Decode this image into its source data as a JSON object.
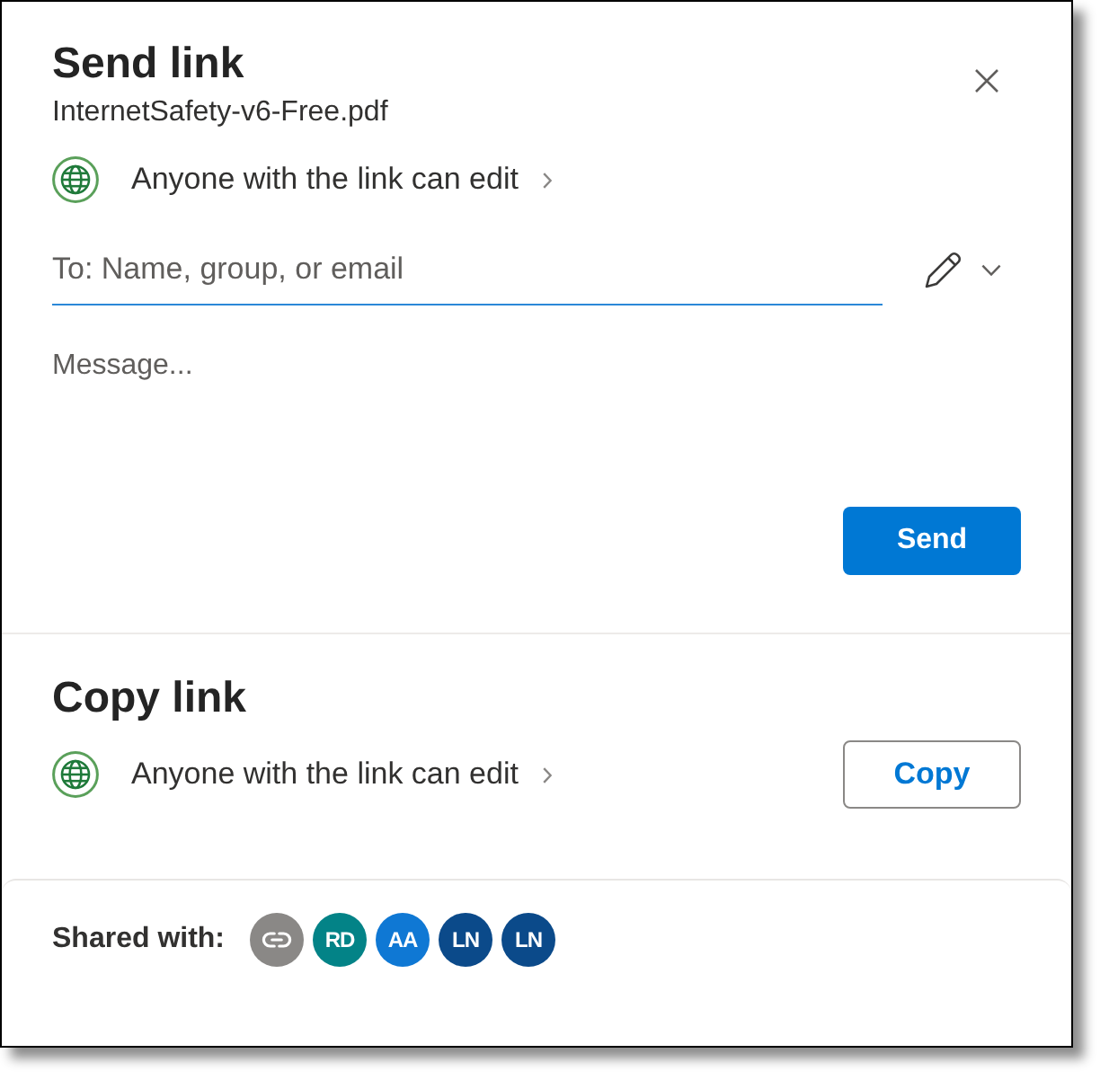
{
  "send_link": {
    "title": "Send link",
    "file_name": "InternetSafety-v6-Free.pdf",
    "permission": "Anyone with the link can edit",
    "recipient_field": {
      "placeholder": "To: Name, group, or email",
      "focused": true
    },
    "message_field": {
      "placeholder": "Message..."
    },
    "send_button": "Send"
  },
  "copy_link": {
    "title": "Copy link",
    "permission": "Anyone with the link can edit",
    "copy_button": "Copy"
  },
  "shared_with": {
    "label": "Shared with:",
    "people": [
      {
        "kind": "link",
        "color": "#8a8886"
      },
      {
        "kind": "initials",
        "initials": "RD",
        "color": "#038387"
      },
      {
        "kind": "initials",
        "initials": "AA",
        "color": "#0f78d4"
      },
      {
        "kind": "initials",
        "initials": "LN",
        "color": "#0b4a8a"
      },
      {
        "kind": "initials",
        "initials": "LN",
        "color": "#0b4a8a"
      }
    ]
  }
}
